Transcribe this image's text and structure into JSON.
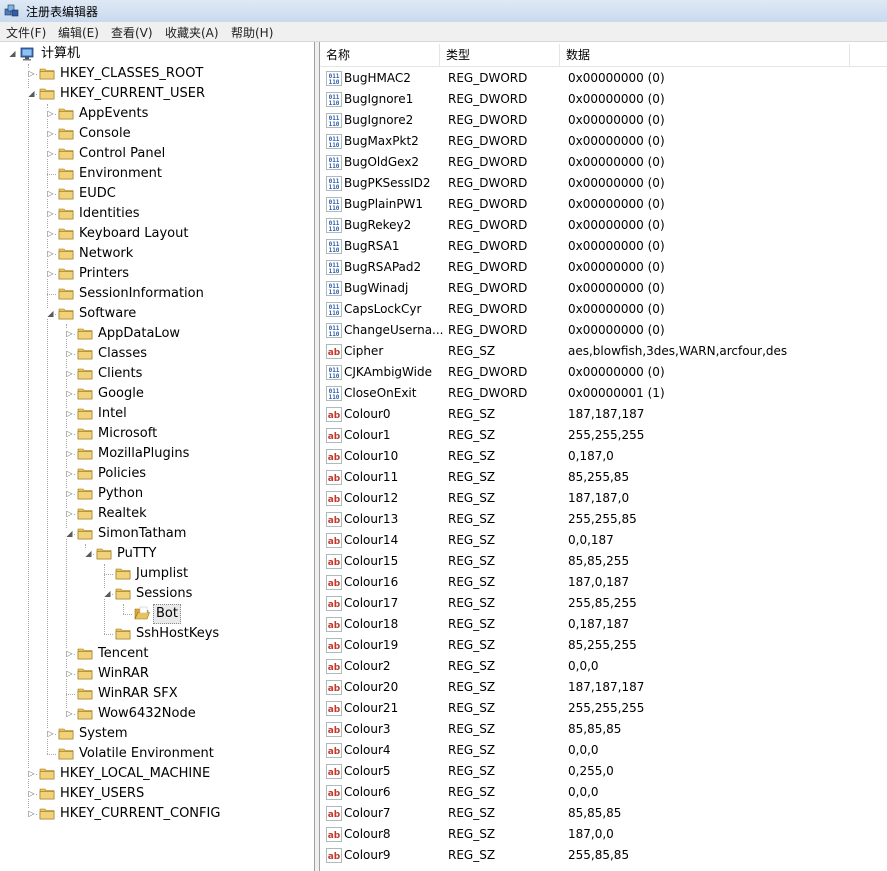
{
  "window": {
    "title": "注册表编辑器"
  },
  "menu": [
    "文件(F)",
    "编辑(E)",
    "查看(V)",
    "收藏夹(A)",
    "帮助(H)"
  ],
  "tree": [
    {
      "label": "计算机",
      "level": 0,
      "exp": "open",
      "icon": "computer-icon"
    },
    {
      "label": "HKEY_CLASSES_ROOT",
      "level": 1,
      "exp": "closed"
    },
    {
      "label": "HKEY_CURRENT_USER",
      "level": 1,
      "exp": "open"
    },
    {
      "label": "AppEvents",
      "level": 2,
      "exp": "closed"
    },
    {
      "label": "Console",
      "level": 2,
      "exp": "closed"
    },
    {
      "label": "Control Panel",
      "level": 2,
      "exp": "closed"
    },
    {
      "label": "Environment",
      "level": 2,
      "exp": "none"
    },
    {
      "label": "EUDC",
      "level": 2,
      "exp": "closed"
    },
    {
      "label": "Identities",
      "level": 2,
      "exp": "closed"
    },
    {
      "label": "Keyboard Layout",
      "level": 2,
      "exp": "closed"
    },
    {
      "label": "Network",
      "level": 2,
      "exp": "closed"
    },
    {
      "label": "Printers",
      "level": 2,
      "exp": "closed"
    },
    {
      "label": "SessionInformation",
      "level": 2,
      "exp": "none"
    },
    {
      "label": "Software",
      "level": 2,
      "exp": "open"
    },
    {
      "label": "AppDataLow",
      "level": 3,
      "exp": "closed"
    },
    {
      "label": "Classes",
      "level": 3,
      "exp": "closed"
    },
    {
      "label": "Clients",
      "level": 3,
      "exp": "closed"
    },
    {
      "label": "Google",
      "level": 3,
      "exp": "closed"
    },
    {
      "label": "Intel",
      "level": 3,
      "exp": "closed"
    },
    {
      "label": "Microsoft",
      "level": 3,
      "exp": "closed"
    },
    {
      "label": "MozillaPlugins",
      "level": 3,
      "exp": "closed"
    },
    {
      "label": "Policies",
      "level": 3,
      "exp": "closed"
    },
    {
      "label": "Python",
      "level": 3,
      "exp": "closed"
    },
    {
      "label": "Realtek",
      "level": 3,
      "exp": "closed"
    },
    {
      "label": "SimonTatham",
      "level": 3,
      "exp": "open"
    },
    {
      "label": "PuTTY",
      "level": 4,
      "exp": "open"
    },
    {
      "label": "Jumplist",
      "level": 5,
      "exp": "none"
    },
    {
      "label": "Sessions",
      "level": 5,
      "exp": "open"
    },
    {
      "label": "Bot",
      "level": 6,
      "exp": "none",
      "selected": true,
      "icon": "open-folder-icon"
    },
    {
      "label": "SshHostKeys",
      "level": 5,
      "exp": "none"
    },
    {
      "label": "Tencent",
      "level": 3,
      "exp": "closed"
    },
    {
      "label": "WinRAR",
      "level": 3,
      "exp": "closed"
    },
    {
      "label": "WinRAR SFX",
      "level": 3,
      "exp": "none"
    },
    {
      "label": "Wow6432Node",
      "level": 3,
      "exp": "closed"
    },
    {
      "label": "System",
      "level": 2,
      "exp": "closed"
    },
    {
      "label": "Volatile Environment",
      "level": 2,
      "exp": "none"
    },
    {
      "label": "HKEY_LOCAL_MACHINE",
      "level": 1,
      "exp": "closed"
    },
    {
      "label": "HKEY_USERS",
      "level": 1,
      "exp": "closed"
    },
    {
      "label": "HKEY_CURRENT_CONFIG",
      "level": 1,
      "exp": "closed"
    }
  ],
  "list": {
    "headers": {
      "name": "名称",
      "type": "类型",
      "data": "数据"
    },
    "rows": [
      {
        "name": "BugHMAC2",
        "type": "REG_DWORD",
        "data": "0x00000000 (0)",
        "icon": "dword-value-icon"
      },
      {
        "name": "BugIgnore1",
        "type": "REG_DWORD",
        "data": "0x00000000 (0)",
        "icon": "dword-value-icon"
      },
      {
        "name": "BugIgnore2",
        "type": "REG_DWORD",
        "data": "0x00000000 (0)",
        "icon": "dword-value-icon"
      },
      {
        "name": "BugMaxPkt2",
        "type": "REG_DWORD",
        "data": "0x00000000 (0)",
        "icon": "dword-value-icon"
      },
      {
        "name": "BugOldGex2",
        "type": "REG_DWORD",
        "data": "0x00000000 (0)",
        "icon": "dword-value-icon"
      },
      {
        "name": "BugPKSessID2",
        "type": "REG_DWORD",
        "data": "0x00000000 (0)",
        "icon": "dword-value-icon"
      },
      {
        "name": "BugPlainPW1",
        "type": "REG_DWORD",
        "data": "0x00000000 (0)",
        "icon": "dword-value-icon"
      },
      {
        "name": "BugRekey2",
        "type": "REG_DWORD",
        "data": "0x00000000 (0)",
        "icon": "dword-value-icon"
      },
      {
        "name": "BugRSA1",
        "type": "REG_DWORD",
        "data": "0x00000000 (0)",
        "icon": "dword-value-icon"
      },
      {
        "name": "BugRSAPad2",
        "type": "REG_DWORD",
        "data": "0x00000000 (0)",
        "icon": "dword-value-icon"
      },
      {
        "name": "BugWinadj",
        "type": "REG_DWORD",
        "data": "0x00000000 (0)",
        "icon": "dword-value-icon"
      },
      {
        "name": "CapsLockCyr",
        "type": "REG_DWORD",
        "data": "0x00000000 (0)",
        "icon": "dword-value-icon"
      },
      {
        "name": "ChangeUserna...",
        "type": "REG_DWORD",
        "data": "0x00000000 (0)",
        "icon": "dword-value-icon"
      },
      {
        "name": "Cipher",
        "type": "REG_SZ",
        "data": "aes,blowfish,3des,WARN,arcfour,des",
        "icon": "string-value-icon"
      },
      {
        "name": "CJKAmbigWide",
        "type": "REG_DWORD",
        "data": "0x00000000 (0)",
        "icon": "dword-value-icon"
      },
      {
        "name": "CloseOnExit",
        "type": "REG_DWORD",
        "data": "0x00000001 (1)",
        "icon": "dword-value-icon"
      },
      {
        "name": "Colour0",
        "type": "REG_SZ",
        "data": "187,187,187",
        "icon": "string-value-icon"
      },
      {
        "name": "Colour1",
        "type": "REG_SZ",
        "data": "255,255,255",
        "icon": "string-value-icon"
      },
      {
        "name": "Colour10",
        "type": "REG_SZ",
        "data": "0,187,0",
        "icon": "string-value-icon"
      },
      {
        "name": "Colour11",
        "type": "REG_SZ",
        "data": "85,255,85",
        "icon": "string-value-icon"
      },
      {
        "name": "Colour12",
        "type": "REG_SZ",
        "data": "187,187,0",
        "icon": "string-value-icon"
      },
      {
        "name": "Colour13",
        "type": "REG_SZ",
        "data": "255,255,85",
        "icon": "string-value-icon"
      },
      {
        "name": "Colour14",
        "type": "REG_SZ",
        "data": "0,0,187",
        "icon": "string-value-icon"
      },
      {
        "name": "Colour15",
        "type": "REG_SZ",
        "data": "85,85,255",
        "icon": "string-value-icon"
      },
      {
        "name": "Colour16",
        "type": "REG_SZ",
        "data": "187,0,187",
        "icon": "string-value-icon"
      },
      {
        "name": "Colour17",
        "type": "REG_SZ",
        "data": "255,85,255",
        "icon": "string-value-icon"
      },
      {
        "name": "Colour18",
        "type": "REG_SZ",
        "data": "0,187,187",
        "icon": "string-value-icon"
      },
      {
        "name": "Colour19",
        "type": "REG_SZ",
        "data": "85,255,255",
        "icon": "string-value-icon"
      },
      {
        "name": "Colour2",
        "type": "REG_SZ",
        "data": "0,0,0",
        "icon": "string-value-icon"
      },
      {
        "name": "Colour20",
        "type": "REG_SZ",
        "data": "187,187,187",
        "icon": "string-value-icon"
      },
      {
        "name": "Colour21",
        "type": "REG_SZ",
        "data": "255,255,255",
        "icon": "string-value-icon"
      },
      {
        "name": "Colour3",
        "type": "REG_SZ",
        "data": "85,85,85",
        "icon": "string-value-icon"
      },
      {
        "name": "Colour4",
        "type": "REG_SZ",
        "data": "0,0,0",
        "icon": "string-value-icon"
      },
      {
        "name": "Colour5",
        "type": "REG_SZ",
        "data": "0,255,0",
        "icon": "string-value-icon"
      },
      {
        "name": "Colour6",
        "type": "REG_SZ",
        "data": "0,0,0",
        "icon": "string-value-icon"
      },
      {
        "name": "Colour7",
        "type": "REG_SZ",
        "data": "85,85,85",
        "icon": "string-value-icon"
      },
      {
        "name": "Colour8",
        "type": "REG_SZ",
        "data": "187,0,0",
        "icon": "string-value-icon"
      },
      {
        "name": "Colour9",
        "type": "REG_SZ",
        "data": "255,85,85",
        "icon": "string-value-icon"
      }
    ]
  },
  "colors": {
    "folder": "#e8c35a",
    "dword_icon": "#2f5ea8",
    "string_icon": "#c0392b",
    "pane_border": "#a0a0a0"
  }
}
